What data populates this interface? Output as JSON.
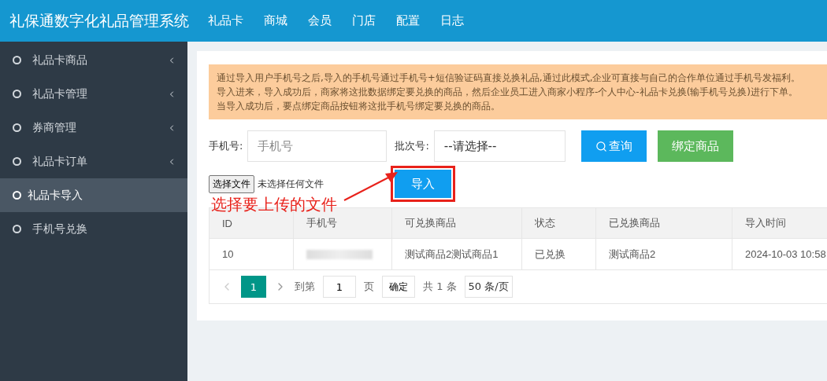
{
  "header": {
    "title": "礼保通数字化礼品管理系统",
    "nav": [
      {
        "label": "礼品卡"
      },
      {
        "label": "商城"
      },
      {
        "label": "会员"
      },
      {
        "label": "门店"
      },
      {
        "label": "配置"
      },
      {
        "label": "日志"
      }
    ]
  },
  "sidebar": {
    "items": [
      {
        "label": "礼品卡商品",
        "submenu": true,
        "selected": false
      },
      {
        "label": "礼品卡管理",
        "submenu": true,
        "selected": false
      },
      {
        "label": "券商管理",
        "submenu": true,
        "selected": false
      },
      {
        "label": "礼品卡订单",
        "submenu": true,
        "selected": false
      },
      {
        "label": "礼品卡导入",
        "submenu": false,
        "selected": true
      },
      {
        "label": "手机号兑换",
        "submenu": false,
        "selected": false
      }
    ]
  },
  "notice": [
    "通过导入用户手机号之后,导入的手机号通过手机号+短信验证码直接兑换礼品,通过此模式,企业可直接与自己的合作单位通过手机号发福利。",
    "导入进来，导入成功后，商家将这批数据绑定要兑换的商品，然后企业员工进入商家小程序-个人中心-礼品卡兑换(输手机号兑换)进行下单。",
    "当导入成功后，要点绑定商品按钮将这批手机号绑定要兑换的商品。"
  ],
  "filters": {
    "phone_label": "手机号:",
    "phone_placeholder": "手机号",
    "batch_label": "批次号:",
    "batch_value": "--请选择--",
    "search_button": "查询",
    "bind_button": "绑定商品"
  },
  "upload": {
    "choose_button": "选择文件",
    "no_file": "未选择任何文件",
    "import_button": "导入"
  },
  "annotation": {
    "text": "选择要上传的文件"
  },
  "table": {
    "columns": [
      "ID",
      "手机号",
      "可兑换商品",
      "状态",
      "已兑换商品",
      "导入时间"
    ],
    "rows": [
      {
        "id": "10",
        "phone_blurred": true,
        "goods": "测试商品2测试商品1",
        "status": "已兑换",
        "redeemed": "测试商品2",
        "time": "2024-10-03 10:58"
      }
    ]
  },
  "pagination": {
    "pages": [
      {
        "label": "1",
        "selected": true
      }
    ],
    "goto_label": "到第",
    "goto_value": "1",
    "page_unit": "页",
    "confirm": "确定",
    "total": "共 1 条",
    "page_size": "50 条/页"
  }
}
